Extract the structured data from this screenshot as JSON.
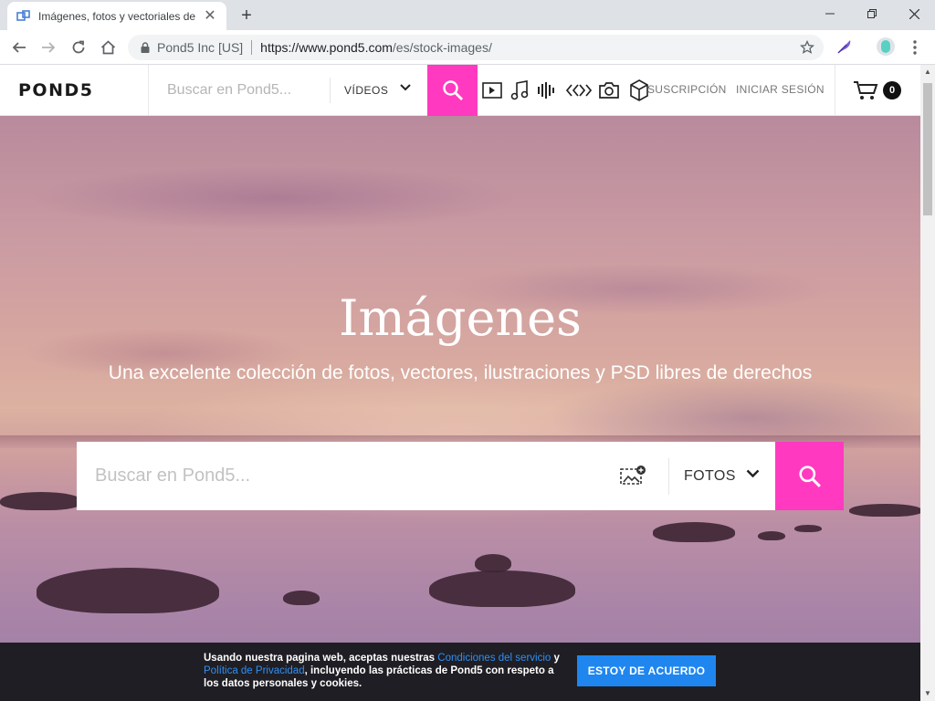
{
  "browser": {
    "tab_title": "Imágenes, fotos y vectoriales de",
    "site_identity": "Pond5 Inc [US]",
    "url_host": "https://www.pond5.com",
    "url_path": "/es/stock-images/"
  },
  "header": {
    "logo": "POND5",
    "search_placeholder": "Buscar en Pond5...",
    "media_type": "VÍDEOS",
    "subscription_link": "SUSCRIPCIÓN",
    "login_link": "INICIAR SESIÓN",
    "cart_count": "0",
    "category_icons": [
      "video-icon",
      "music-icon",
      "sound-effects-icon",
      "after-effects-icon",
      "photo-icon",
      "3d-model-icon"
    ]
  },
  "hero": {
    "title": "Imágenes",
    "subtitle": "Una excelente colección de fotos, vectores, ilustraciones y PSD libres de derechos",
    "search_placeholder": "Buscar en Pond5...",
    "media_type": "FOTOS"
  },
  "cookie": {
    "text_1": "Usando nuestra pagina web, aceptas nuestras ",
    "link_terms": "Condiciones del servicio",
    "text_2": " y ",
    "link_privacy": "Política de Privacidad",
    "text_3": ", incluyendo las prácticas de Pond5 con respeto a los datos personales y cookies.",
    "button": "ESTOY DE ACUERDO"
  },
  "colors": {
    "accent": "#ff3ac0",
    "cookie_button": "#1f86f0",
    "cookie_bg": "#1e1e24"
  }
}
